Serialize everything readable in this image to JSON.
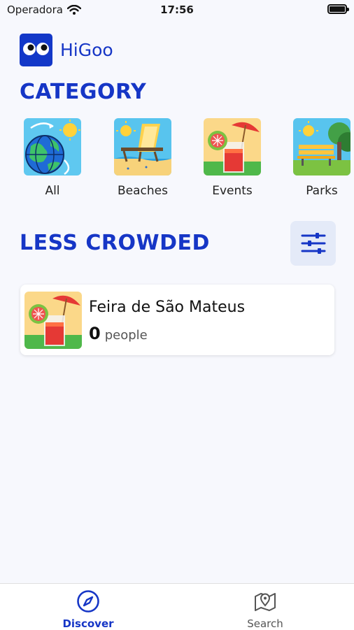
{
  "status_bar": {
    "carrier": "Operadora",
    "time": "17:56"
  },
  "header": {
    "app_name": "HiGoo"
  },
  "categories": {
    "title": "CATEGORY",
    "items": [
      {
        "label": "All",
        "selected": true
      },
      {
        "label": "Beaches",
        "selected": false
      },
      {
        "label": "Events",
        "selected": false
      },
      {
        "label": "Parks",
        "selected": false
      }
    ]
  },
  "less_crowded": {
    "title": "LESS CROWDED",
    "places": [
      {
        "name": "Feira de São Mateus",
        "count": "0",
        "unit": "people"
      }
    ]
  },
  "tab_bar": {
    "tabs": [
      {
        "label": "Discover",
        "icon": "compass-icon",
        "active": true
      },
      {
        "label": "Search",
        "icon": "map-pin-icon",
        "active": false
      }
    ]
  },
  "colors": {
    "brand": "#1636c6",
    "background": "#f7f8fd",
    "filter_bg": "#e4eaf8"
  }
}
